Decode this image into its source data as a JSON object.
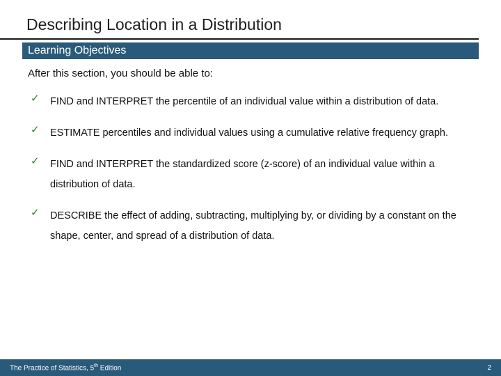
{
  "title": "Describing Location in a Distribution",
  "subtitle": "Learning Objectives",
  "intro": "After this section, you should be able to:",
  "objectives": [
    "FIND and INTERPRET the percentile of an individual value within a distribution of data.",
    "ESTIMATE percentiles and individual values using a cumulative relative frequency graph.",
    "FIND and INTERPRET the standardized score (z-score) of an individual value within a distribution of data.",
    "DESCRIBE the effect of adding, subtracting, multiplying by, or dividing by a constant on the shape, center, and spread of a distribution of data."
  ],
  "footer": {
    "text_prefix": "The Practice of Statistics, 5",
    "text_sup": "th",
    "text_suffix": " Edition",
    "page": "2"
  }
}
